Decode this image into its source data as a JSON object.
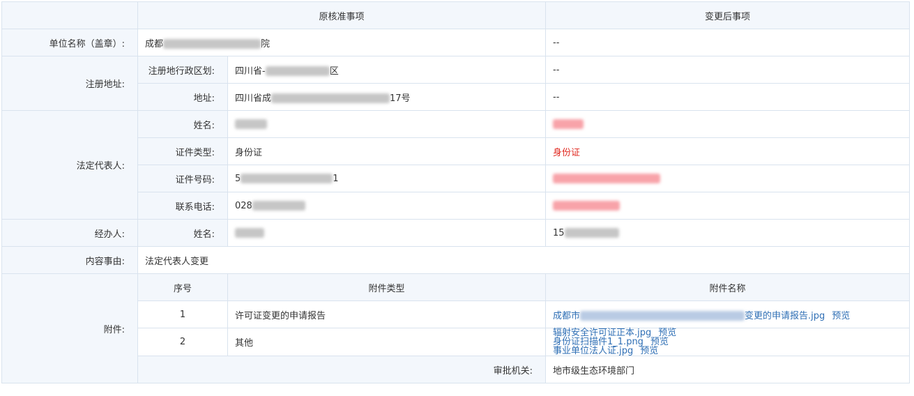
{
  "header": {
    "original": "原核准事项",
    "changed": "变更后事项"
  },
  "unit": {
    "label": "单位名称（盖章）:",
    "original_prefix": "成都",
    "original_suffix": "院",
    "changed": "--"
  },
  "address": {
    "label": "注册地址:",
    "region_label": "注册地行政区划:",
    "region_prefix": "四川省-",
    "region_suffix": "区",
    "region_changed": "--",
    "addr_label": "地址:",
    "addr_prefix": "四川省成",
    "addr_suffix": "17号",
    "addr_changed": "--"
  },
  "legal": {
    "label": "法定代表人:",
    "name_label": "姓名:",
    "idtype_label": "证件类型:",
    "idtype_original": "身份证",
    "idtype_changed": "身份证",
    "idnum_label": "证件号码:",
    "idnum_original_prefix": "5",
    "idnum_original_suffix": "1",
    "phone_label": "联系电话:",
    "phone_original_prefix": "028"
  },
  "handler": {
    "label": "经办人:",
    "name_label": "姓名:",
    "changed_prefix": "15"
  },
  "content": {
    "label": "内容事由:",
    "value": "法定代表人变更"
  },
  "attachments": {
    "label": "附件:",
    "col_seq": "序号",
    "col_type": "附件类型",
    "col_name": "附件名称",
    "preview_label": "预览",
    "rows": [
      {
        "seq": "1",
        "type": "许可证变更的申请报告",
        "file_prefix": "成都市",
        "file_suffix": "变更的申请报告.jpg"
      },
      {
        "seq": "2",
        "type": "其他",
        "files": [
          "辐射安全许可证正本.jpg",
          "身份证扫描件1_1.png",
          "事业单位法人证.jpg"
        ]
      }
    ]
  },
  "approval": {
    "label": "审批机关:",
    "value": "地市级生态环境部门"
  }
}
